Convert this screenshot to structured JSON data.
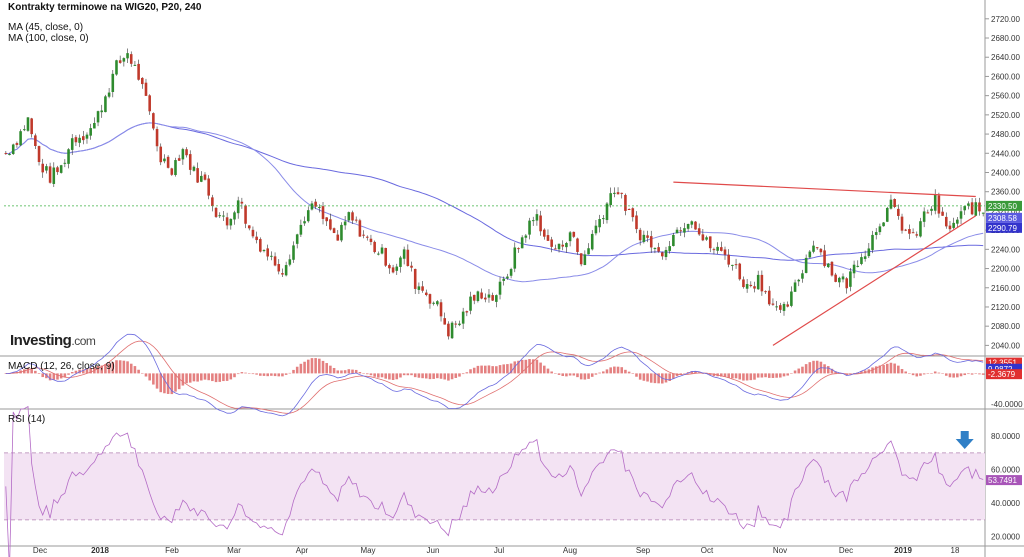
{
  "title": "Kontrakty terminowe na WIG20, P20, 240",
  "legend": [
    "MA (45, close, 0)",
    "MA (100, close, 0)"
  ],
  "macd_label": "MACD (12, 26, close, 9)",
  "rsi_label": "RSI (14)",
  "brand": {
    "name": "Investing",
    "suffix": ".com"
  },
  "colors": {
    "up": "#2e8b2e",
    "down": "#c0392b",
    "ma45": "#8a8ce8",
    "ma100": "#6a6adf",
    "price_line": "#3cb043",
    "trend": "#e04a4a",
    "rsi_band": "#f3e3f3",
    "rsi_line": "#b46cc6",
    "arrow": "#2f7fc6"
  },
  "chart_data": [
    {
      "type": "candlestick",
      "title": "Kontrakty terminowe na WIG20, P20, 240",
      "ylim": [
        2020,
        2730
      ],
      "y_ticks": [
        "2720.00",
        "2680.00",
        "2640.00",
        "2600.00",
        "2560.00",
        "2520.00",
        "2480.00",
        "2440.00",
        "2400.00",
        "2360.00",
        "2320.00",
        "2280.00",
        "2240.00",
        "2200.00",
        "2160.00",
        "2120.00",
        "2080.00",
        "2040.00"
      ],
      "x_ticks": [
        "Dec",
        "2018",
        "Feb",
        "Mar",
        "Apr",
        "May",
        "Jun",
        "Jul",
        "Aug",
        "Sep",
        "Oct",
        "Nov",
        "Dec",
        "2019",
        "18"
      ],
      "close_path": [
        [
          0,
          2440
        ],
        [
          3,
          2470
        ],
        [
          6,
          2510
        ],
        [
          9,
          2420
        ],
        [
          12,
          2390
        ],
        [
          15,
          2410
        ],
        [
          18,
          2470
        ],
        [
          21,
          2480
        ],
        [
          24,
          2500
        ],
        [
          27,
          2560
        ],
        [
          30,
          2620
        ],
        [
          33,
          2650
        ],
        [
          36,
          2600
        ],
        [
          39,
          2520
        ],
        [
          42,
          2430
        ],
        [
          45,
          2410
        ],
        [
          48,
          2450
        ],
        [
          51,
          2400
        ],
        [
          54,
          2380
        ],
        [
          57,
          2320
        ],
        [
          60,
          2290
        ],
        [
          63,
          2350
        ],
        [
          66,
          2280
        ],
        [
          69,
          2250
        ],
        [
          72,
          2220
        ],
        [
          75,
          2200
        ],
        [
          78,
          2250
        ],
        [
          81,
          2310
        ],
        [
          84,
          2330
        ],
        [
          87,
          2290
        ],
        [
          90,
          2260
        ],
        [
          93,
          2310
        ],
        [
          96,
          2280
        ],
        [
          99,
          2250
        ],
        [
          102,
          2230
        ],
        [
          105,
          2200
        ],
        [
          108,
          2230
        ],
        [
          111,
          2170
        ],
        [
          114,
          2150
        ],
        [
          117,
          2120
        ],
        [
          120,
          2070
        ],
        [
          123,
          2090
        ],
        [
          126,
          2130
        ],
        [
          129,
          2150
        ],
        [
          132,
          2140
        ],
        [
          135,
          2170
        ],
        [
          138,
          2230
        ],
        [
          141,
          2280
        ],
        [
          144,
          2310
        ],
        [
          147,
          2250
        ],
        [
          150,
          2240
        ],
        [
          153,
          2280
        ],
        [
          156,
          2210
        ],
        [
          159,
          2270
        ],
        [
          162,
          2320
        ],
        [
          165,
          2370
        ],
        [
          168,
          2330
        ],
        [
          171,
          2280
        ],
        [
          174,
          2260
        ],
        [
          177,
          2230
        ],
        [
          180,
          2260
        ],
        [
          183,
          2290
        ],
        [
          186,
          2310
        ],
        [
          189,
          2260
        ],
        [
          192,
          2240
        ],
        [
          195,
          2230
        ],
        [
          198,
          2200
        ],
        [
          201,
          2160
        ],
        [
          204,
          2180
        ],
        [
          207,
          2140
        ],
        [
          210,
          2100
        ],
        [
          213,
          2140
        ],
        [
          216,
          2200
        ],
        [
          219,
          2260
        ],
        [
          222,
          2220
        ],
        [
          225,
          2180
        ],
        [
          228,
          2170
        ],
        [
          231,
          2220
        ],
        [
          234,
          2250
        ],
        [
          237,
          2300
        ],
        [
          240,
          2330
        ],
        [
          243,
          2290
        ],
        [
          246,
          2260
        ],
        [
          249,
          2310
        ],
        [
          252,
          2340
        ],
        [
          255,
          2280
        ],
        [
          258,
          2300
        ],
        [
          261,
          2330
        ],
        [
          264,
          2320
        ]
      ],
      "current_price": "2330.50",
      "ma45_last": "2308.58",
      "ma100_last": "2290.79",
      "trendline_upper": [
        [
          181,
          2380
        ],
        [
          263,
          2350
        ]
      ],
      "trendline_lower": [
        [
          208,
          2040
        ],
        [
          263,
          2310
        ]
      ]
    },
    {
      "type": "macd",
      "title": "MACD (12, 26, close, 9)",
      "ylim": [
        -45,
        20
      ],
      "y_ticks": [
        "-40.0000"
      ],
      "last_values": [
        "12.3551",
        "9.9872",
        "-2.3679"
      ]
    },
    {
      "type": "rsi",
      "title": "RSI (14)",
      "ylim": [
        15,
        95
      ],
      "y_ticks": [
        "80.0000",
        "60.0000",
        "40.0000",
        "20.0000"
      ],
      "band": [
        30,
        70
      ],
      "last_value": "53.7491"
    }
  ]
}
